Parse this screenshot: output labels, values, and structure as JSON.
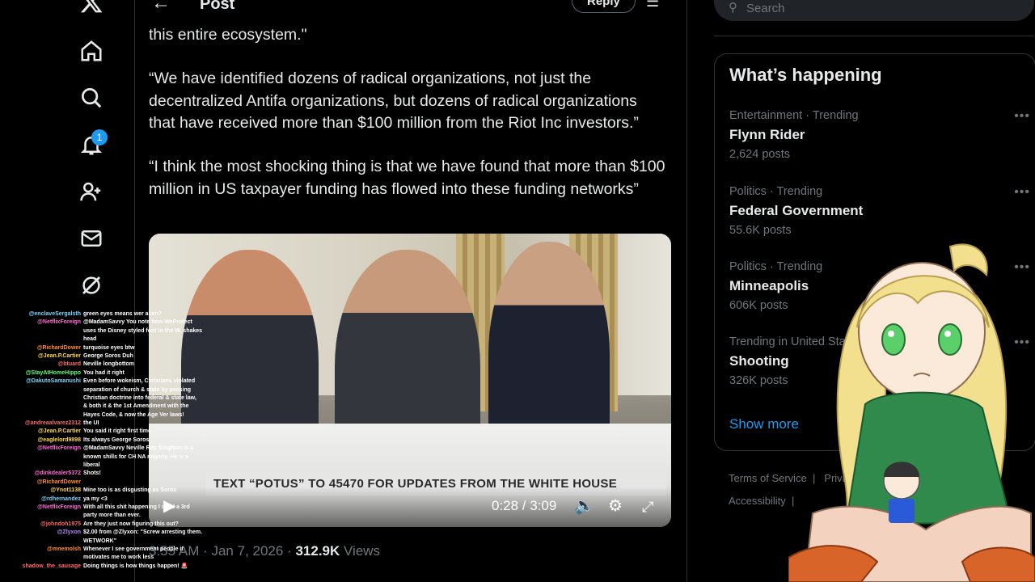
{
  "nav": {
    "items": [
      "x-logo",
      "home",
      "explore",
      "notifications",
      "follow",
      "messages",
      "grok"
    ],
    "notifications_badge": "1"
  },
  "header": {
    "title": "Post",
    "reply_label": "Reply"
  },
  "post": {
    "paragraphs": [
      "this entire ecosystem.\"",
      "“We have identified dozens of radical organizations, not just the decentralized Antifa organizations, but dozens of radical organizations that have received more than $100 million from the Riot Inc investors.”",
      "“I think the most shocking thing is that we have found that more than $100 million in US taxpayer funding has flowed into these funding networks”"
    ],
    "video": {
      "banner": "TEXT “POTUS” TO 45470 FOR UPDATES FROM THE WHITE HOUSE",
      "time": "0:28 / 3:09",
      "progress": 0.148
    },
    "meta_time": "3:55 AM · Jan 7, 2026 · ",
    "views_count": "312.9K",
    "views_label": " Views"
  },
  "search": {
    "placeholder": "Search"
  },
  "trends": {
    "title": "What’s happening",
    "items": [
      {
        "category": "Entertainment · Trending",
        "name": "Flynn Rider",
        "count": "2,624 posts"
      },
      {
        "category": "Politics · Trending",
        "name": "Federal Government",
        "count": "55.6K posts"
      },
      {
        "category": "Politics · Trending",
        "name": "Minneapolis",
        "count": "606K posts"
      },
      {
        "category": "Trending in United Sta",
        "name": "Shooting",
        "count": "326K posts"
      }
    ],
    "show_more": "Show more"
  },
  "footer": {
    "terms": "Terms of Service",
    "privacy": "Privac",
    "accessibility": "Accessibility"
  },
  "chat": [
    {
      "user": "@enclaveSergalsth",
      "msg": "green eyes means wer alien?",
      "color": "#7fd3ff"
    },
    {
      "user": "@NetflixForeign",
      "msg": "@MadamSavvy You note how WeProtect",
      "color": "#ff6bd6"
    },
    {
      "user": "",
      "msg": "uses the Disney styled font in the W. shakes",
      "color": "#ffffff"
    },
    {
      "user": "",
      "msg": "head",
      "color": "#ffffff"
    },
    {
      "user": "@RichardDower",
      "msg": "turquoise eyes btw",
      "color": "#ff8a3d"
    },
    {
      "user": "@Jean.P.Cartier",
      "msg": "George Soros Duh",
      "color": "#ffd84d"
    },
    {
      "user": "@btuard",
      "msg": "Neville longbottom",
      "color": "#ff6b6b"
    },
    {
      "user": "@StayAtHomeHippo",
      "msg": "You had it right",
      "color": "#5cff7a"
    },
    {
      "user": "@DakutoSamanushi",
      "msg": "Even before wokeism, Christians violated",
      "color": "#7fd3ff"
    },
    {
      "user": "",
      "msg": "separation of church & state by passing",
      "color": "#ffffff"
    },
    {
      "user": "",
      "msg": "Christian doctrine into federal & state law,",
      "color": "#ffffff"
    },
    {
      "user": "",
      "msg": "& both it & the 1st Amendment with the",
      "color": "#ffffff"
    },
    {
      "user": "",
      "msg": "Hayes Code, & now the Age Ver laws!",
      "color": "#ffffff"
    },
    {
      "user": "@andreaalvarez2312",
      "msg": "the UI",
      "color": "#ff6b6b"
    },
    {
      "user": "@Jean.P.Cartier",
      "msg": "You said it right first time",
      "color": "#ffd84d"
    },
    {
      "user": "@eaglelord9898",
      "msg": "Its always George Soros",
      "color": "#ffd84d"
    },
    {
      "user": "@NetflixForeign",
      "msg": "@MadamSavvy Neville Roy Singham is a",
      "color": "#ff6bd6"
    },
    {
      "user": "",
      "msg": "known shills for CH NA majorly. He is a",
      "color": "#ffffff"
    },
    {
      "user": "",
      "msg": "liberal",
      "color": "#ffffff"
    },
    {
      "user": "@dinkdealer5372",
      "msg": "Shots!",
      "color": "#ff6bd6"
    },
    {
      "user": "@RichardDower",
      "msg": "",
      "color": "#ff8a3d"
    },
    {
      "user": "@Ynot1138",
      "msg": "Mine too is as disgusting as Soros",
      "color": "#ffd84d"
    },
    {
      "user": "@rdhernandez",
      "msg": "ya my <3",
      "color": "#7fd3ff"
    },
    {
      "user": "@NetflixForeign",
      "msg": "With all this shit happening I need a 3rd",
      "color": "#ff6bd6"
    },
    {
      "user": "",
      "msg": "party more than ever.",
      "color": "#ffffff"
    },
    {
      "user": "@johndoh1975",
      "msg": "Are they just now figuring this out?",
      "color": "#ff6b6b"
    },
    {
      "user": "@Zlyxon",
      "msg": "$2.00 from @Zlyxon: \"Screw arresting them.",
      "color": "#b38cff"
    },
    {
      "user": "",
      "msg": "WETWORK\"",
      "color": "#ffffff"
    },
    {
      "user": "@mnemolsh",
      "msg": "Whenever I see government people it",
      "color": "#ff8a3d"
    },
    {
      "user": "",
      "msg": "motivates me to work less",
      "color": "#ffffff"
    },
    {
      "user": "shadow_the_sausage",
      "msg": "Doing things is how things happen! 🚨",
      "color": "#ff6b6b"
    }
  ]
}
